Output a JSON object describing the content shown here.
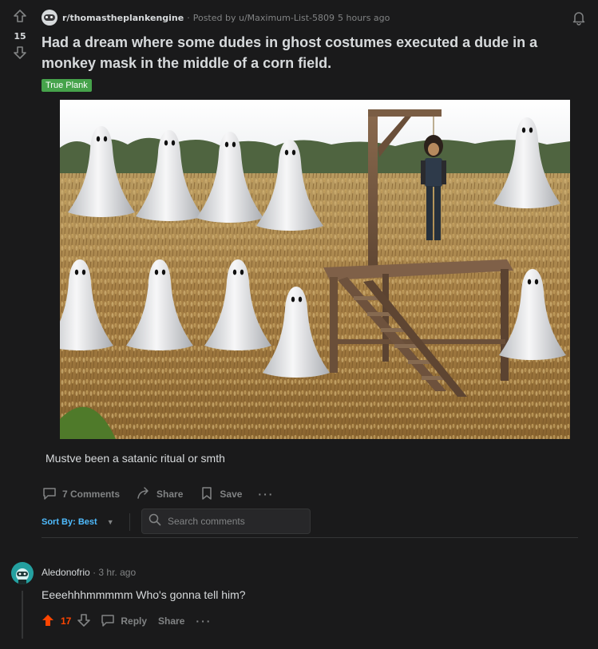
{
  "post": {
    "subreddit": "r/thomastheplankengine",
    "posted_by": "Posted by u/Maximum-List-5809",
    "time": "5 hours ago",
    "score": "15",
    "title": "Had a dream where some dudes in ghost costumes executed a dude in a monkey mask in the middle of a corn field.",
    "flair": "True Plank",
    "flair_color": "#46a34b",
    "body": "Mustve been a satanic ritual or smth"
  },
  "actions": {
    "comments": "7 Comments",
    "share": "Share",
    "save": "Save",
    "more": "···"
  },
  "sort": {
    "label": "Sort By: Best",
    "caret": "▼"
  },
  "search": {
    "placeholder": "Search comments",
    "value": ""
  },
  "comment": {
    "author": "Aledonofrio",
    "separator": "·",
    "time": "3 hr. ago",
    "body": "Eeeehhhmmmmm Who's gonna tell him?",
    "score": "17",
    "reply": "Reply",
    "share": "Share",
    "more": "···"
  },
  "colors": {
    "background": "#1a1a1b",
    "text": "#d7dadc",
    "muted": "#818384",
    "accent": "#4fbcff",
    "upvote": "#ff4500"
  },
  "icons": [
    "upvote-icon",
    "downvote-icon",
    "bell-icon",
    "comment-icon",
    "share-icon",
    "save-icon",
    "search-icon"
  ]
}
